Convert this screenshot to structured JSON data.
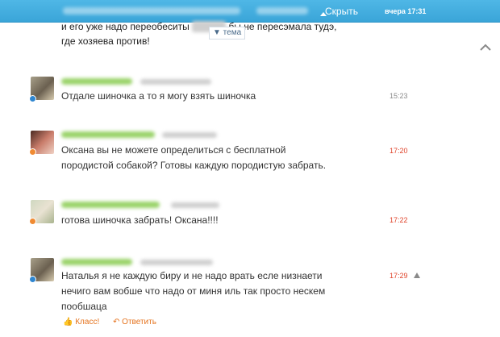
{
  "topbar": {
    "hide_label": "Скрыть",
    "time": "вчера 17:31"
  },
  "previous_message": {
    "line1_prefix": "и его уже надо переобеситы",
    "line1_suffix": "бы не пересэмала тудэ,",
    "line2": "где хозяева против!"
  },
  "tema_label": "▼ тема",
  "messages": [
    {
      "text": "Отдале шиночка а то я могу взять шиночка",
      "time": "15:23",
      "time_color": "gray",
      "status_color": "blue"
    },
    {
      "text_lines": [
        "Оксана вы не можете определиться с бесплатной",
        "породистой собакой? Готовы каждую породистую забрать."
      ],
      "time": "17:20",
      "time_color": "red",
      "status_color": "orange"
    },
    {
      "text": "готова шиночка забрать! Оксана!!!!",
      "time": "17:22",
      "time_color": "red",
      "status_color": "orange"
    },
    {
      "text_lines": [
        "Наталья я не каждую биру и не надо врать есле низнаети",
        "нечиго вам вобше что надо от миня иль так просто нескем",
        "пообшаца"
      ],
      "time": "17:29",
      "time_color": "red",
      "status_color": "blue"
    }
  ],
  "actions": {
    "like_label": "Класс!",
    "reply_label": "Ответить"
  }
}
